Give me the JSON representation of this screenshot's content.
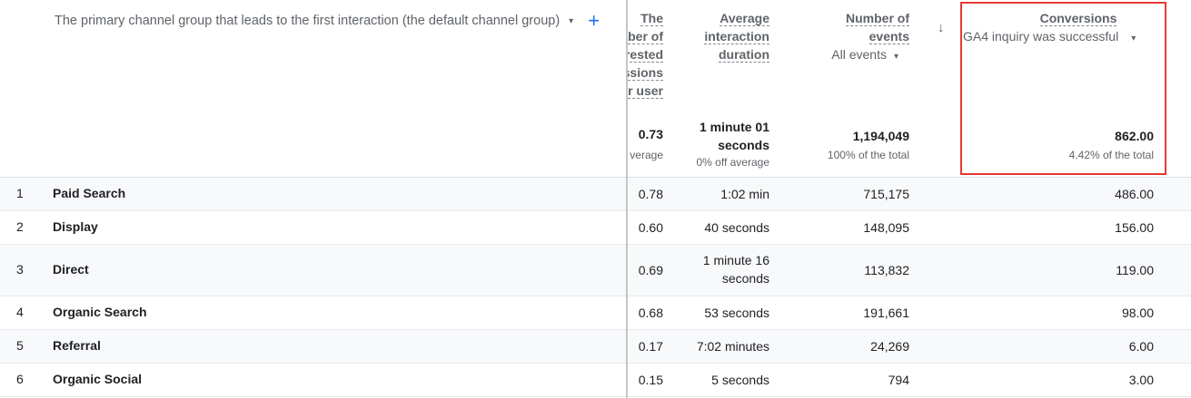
{
  "dimension_header": {
    "label": "The primary channel group that leads to the first interaction (the default channel group)",
    "caret": "▾",
    "add_icon": "+"
  },
  "columns": {
    "engaged_sessions_per_user": {
      "header_lines": [
        "The",
        "ber of",
        "rested",
        "ssions",
        "r user"
      ],
      "total": "0.73",
      "total_sub": "verage"
    },
    "avg_engagement": {
      "header_lines": [
        "Average",
        "interaction",
        "duration"
      ],
      "total_lines": [
        "1 minute 01",
        "seconds"
      ],
      "total_sub": "0% off average"
    },
    "event_count": {
      "header_lines": [
        "Number of",
        "events"
      ],
      "selector": "All events",
      "total": "1,194,049",
      "total_sub": "100% of the total"
    },
    "conversions": {
      "header": "Conversions",
      "selector": "GA4 inquiry was successful",
      "total": "862.00",
      "total_sub": "4.42% of the total"
    }
  },
  "sort_icon": "↓",
  "rows": [
    {
      "index": "1",
      "channel": "Paid Search",
      "eng": "0.78",
      "dur": [
        "1:02 min"
      ],
      "events": "715,175",
      "conv": "486.00"
    },
    {
      "index": "2",
      "channel": "Display",
      "eng": "0.60",
      "dur": [
        "40 seconds"
      ],
      "events": "148,095",
      "conv": "156.00"
    },
    {
      "index": "3",
      "channel": "Direct",
      "eng": "0.69",
      "dur": [
        "1 minute 16",
        "seconds"
      ],
      "events": "113,832",
      "conv": "119.00"
    },
    {
      "index": "4",
      "channel": "Organic Search",
      "eng": "0.68",
      "dur": [
        "53 seconds"
      ],
      "events": "191,661",
      "conv": "98.00"
    },
    {
      "index": "5",
      "channel": "Referral",
      "eng": "0.17",
      "dur": [
        "7:02 minutes"
      ],
      "events": "24,269",
      "conv": "6.00"
    },
    {
      "index": "6",
      "channel": "Organic Social",
      "eng": "0.15",
      "dur": [
        "5 seconds"
      ],
      "events": "794",
      "conv": "3.00"
    }
  ],
  "colors": {
    "accent": "#1a73e8",
    "highlight": "#e53935",
    "alt_row": "#f8f9fa"
  }
}
